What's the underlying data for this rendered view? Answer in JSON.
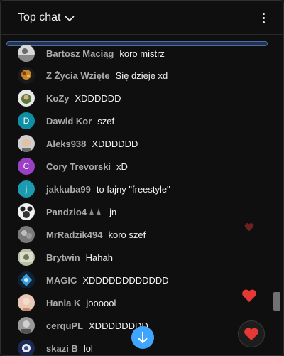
{
  "header": {
    "title": "Top chat",
    "dropdown_icon": "chevron-down-icon",
    "menu_icon": "more-vertical-icon"
  },
  "messages": [
    {
      "author": "Bartosz Maciąg",
      "text": "koro mistrz",
      "avatar": "photo"
    },
    {
      "author": "Z Życia Wzięte",
      "text": "Się dzieje xd",
      "avatar": "photo"
    },
    {
      "author": "KoZy",
      "text": "XDDDDDD",
      "avatar": "photo"
    },
    {
      "author": "Dawid Kor",
      "text": "szef",
      "avatar_letter": "D",
      "avatar_color": "#0f8fa3"
    },
    {
      "author": "Aleks938",
      "text": "XDDDDDD",
      "avatar": "photo"
    },
    {
      "author": "Cory Trevorski",
      "text": "xD",
      "avatar_letter": "C",
      "avatar_color": "#9b3fc4"
    },
    {
      "author": "jakkuba99",
      "text": "to fajny \"freestyle\"",
      "avatar_letter": "j",
      "avatar_color": "#1a9bb0"
    },
    {
      "author": "Pandzio4",
      "text": "jn",
      "avatar": "photo",
      "badge": "mod-badges"
    },
    {
      "author": "MrRadzik494",
      "text": "koro szef",
      "avatar": "photo"
    },
    {
      "author": "Brytwin",
      "text": "Hahah",
      "avatar": "photo"
    },
    {
      "author": "MAGIC",
      "text": "XDDDDDDDDDDDD",
      "avatar": "photo"
    },
    {
      "author": "Hania K",
      "text": "joooool",
      "avatar": "photo"
    },
    {
      "author": "cerquPL",
      "text": "XDDDDDDDD",
      "avatar": "photo"
    },
    {
      "author": "skazi B",
      "text": "lol",
      "avatar": "photo"
    }
  ],
  "colors": {
    "accent_blue": "#3ea6ff",
    "heart_red": "#e53935",
    "background": "#0f0f0f",
    "author_gray": "#aaaaaa"
  },
  "icons": {
    "scroll_down": "arrow-down-icon",
    "reaction": "heart-icon"
  }
}
